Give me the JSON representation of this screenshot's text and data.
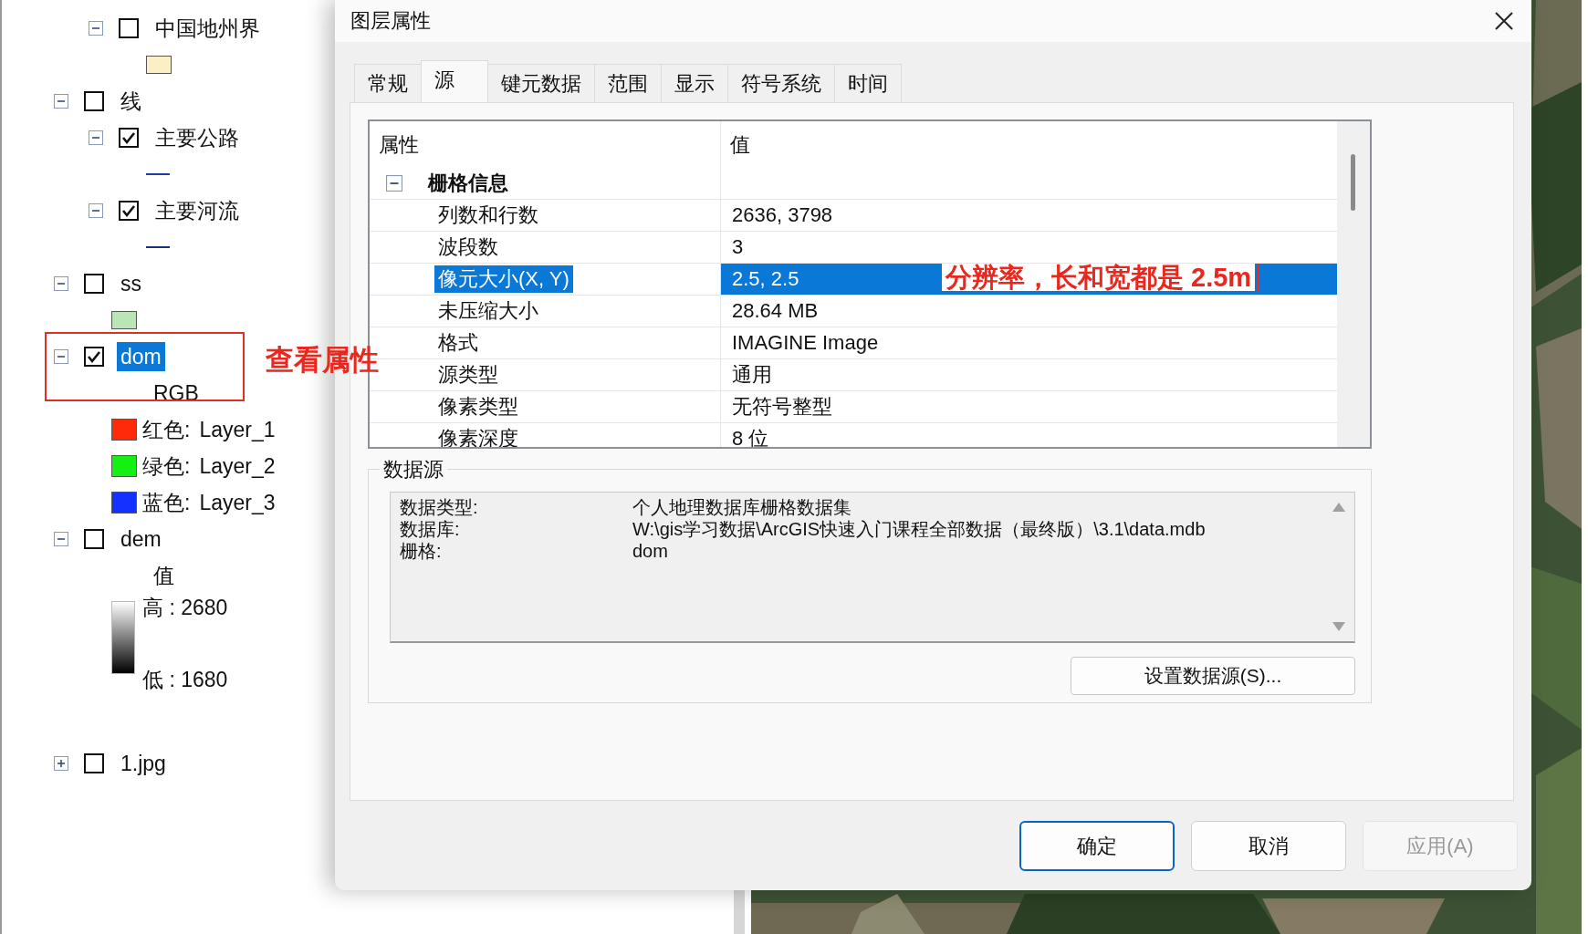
{
  "layers_panel": {
    "items": [
      {
        "children": [
          {
            "name": "中国地州界",
            "checked": false,
            "expanded": true,
            "selected": false,
            "legend": [
              {
                "kind": "fill",
                "color": "#fbefc6"
              }
            ]
          }
        ]
      },
      {
        "name": "线",
        "checked": false,
        "expanded": true,
        "selected": false,
        "children": [
          {
            "name": "主要公路",
            "checked": true,
            "expanded": true,
            "selected": false,
            "legend": [
              {
                "kind": "line",
                "color": "#1f3f9f"
              }
            ]
          },
          {
            "name": "主要河流",
            "checked": true,
            "expanded": true,
            "selected": false,
            "legend": [
              {
                "kind": "line",
                "color": "#1a2f7a"
              }
            ]
          }
        ]
      },
      {
        "name": "ss",
        "checked": false,
        "expanded": true,
        "selected": false,
        "legend": [
          {
            "kind": "fill",
            "color": "#b9e6b4"
          }
        ]
      },
      {
        "name": "dom",
        "checked": true,
        "expanded": true,
        "selected": true,
        "legend": [
          {
            "kind": "text",
            "text": "RGB"
          },
          {
            "kind": "band",
            "color": "#ff2a0a",
            "label": "红色:",
            "value": "Layer_1"
          },
          {
            "kind": "band",
            "color": "#14f014",
            "label": "绿色:",
            "value": "Layer_2"
          },
          {
            "kind": "band",
            "color": "#1432ff",
            "label": "蓝色:",
            "value": "Layer_3"
          }
        ]
      },
      {
        "name": "dem",
        "checked": false,
        "expanded": true,
        "selected": false,
        "legend": [
          {
            "kind": "text",
            "text": "值"
          },
          {
            "kind": "ramp",
            "high": "高 : 2680",
            "low": "低 : 1680"
          }
        ]
      },
      {
        "name": "1.jpg",
        "checked": false,
        "expanded": false,
        "selected": false
      }
    ]
  },
  "dialog": {
    "title": "图层属性",
    "tabs": [
      {
        "label": "常规",
        "selected": false
      },
      {
        "label": "源",
        "selected": true
      },
      {
        "label": "键元数据",
        "selected": false
      },
      {
        "label": "范围",
        "selected": false
      },
      {
        "label": "显示",
        "selected": false
      },
      {
        "label": "符号系统",
        "selected": false
      },
      {
        "label": "时间",
        "selected": false
      }
    ],
    "properties": {
      "columns": [
        "属性",
        "值"
      ],
      "group": {
        "label": "栅格信息",
        "expanded": true,
        "rows": [
          {
            "name": "列数和行数",
            "value": "2636, 3798",
            "selected": false
          },
          {
            "name": "波段数",
            "value": "3",
            "selected": false
          },
          {
            "name": "像元大小(X, Y)",
            "value": "2.5, 2.5",
            "selected": true
          },
          {
            "name": "未压缩大小",
            "value": "28.64 MB",
            "selected": false
          },
          {
            "name": "格式",
            "value": "IMAGINE Image",
            "selected": false
          },
          {
            "name": "源类型",
            "value": "通用",
            "selected": false
          },
          {
            "name": "像素类型",
            "value": "无符号整型",
            "selected": false
          },
          {
            "name": "像素深度",
            "value": "8 位",
            "selected": false
          }
        ]
      }
    },
    "data_source": {
      "title": "数据源",
      "lines": [
        {
          "label": "数据类型:",
          "value": "个人地理数据库栅格数据集"
        },
        {
          "label": "数据库:",
          "value": "W:\\gis学习数据\\ArcGIS快速入门课程全部数据（最终版）\\3.1\\data.mdb"
        },
        {
          "label": "栅格:",
          "value": "dom"
        }
      ],
      "button": "设置数据源(S)..."
    },
    "buttons": [
      {
        "label": "确定",
        "kind": "default",
        "disabled": false
      },
      {
        "label": "取消",
        "kind": "normal",
        "disabled": false
      },
      {
        "label": "应用(A)",
        "kind": "normal",
        "disabled": true
      }
    ]
  },
  "annotations": [
    {
      "kind": "box-note",
      "text": "查看属性"
    },
    {
      "kind": "inline-note",
      "text": "分辨率，长和宽都是 2.5m"
    }
  ]
}
